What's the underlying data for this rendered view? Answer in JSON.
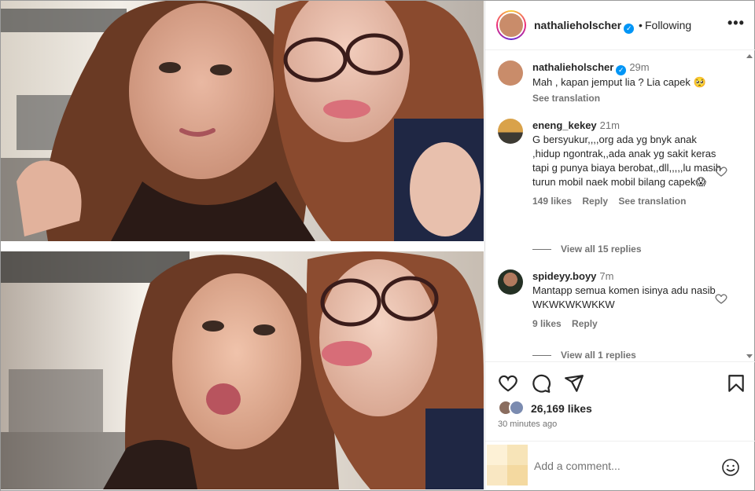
{
  "post": {
    "username": "nathalieholscher",
    "follow_status": "Following",
    "dot": "•",
    "more": "•••"
  },
  "caption": {
    "username": "nathalieholscher",
    "time": "29m",
    "text": "Mah , kapan jemput lia ? Lia capek 🥺",
    "see_translation": "See translation"
  },
  "comments": [
    {
      "username": "eneng_kekey",
      "time": "21m",
      "text": "G bersyukur,,,,org ada yg bnyk anak ,hidup ngontrak,,ada anak yg sakit keras tapi g punya biaya berobat,,dll,,,,,lu masih turun mobil naek mobil bilang capek😱",
      "likes": "149 likes",
      "reply": "Reply",
      "see_translation": "See translation",
      "view_replies": "View all 15 replies"
    },
    {
      "username": "spideyy.boyy",
      "time": "7m",
      "text": "Mantapp semua komen isinya adu nasib WKWKWKWKKW",
      "likes": "9 likes",
      "reply": "Reply",
      "view_replies": "View all 1 replies"
    }
  ],
  "engagement": {
    "likes": "26,169 likes",
    "time_ago": "30 minutes ago"
  },
  "composer": {
    "placeholder": "Add a comment..."
  },
  "icons": [
    "heart-icon",
    "comment-icon",
    "share-icon",
    "bookmark-icon",
    "emoji-icon",
    "verified-icon"
  ],
  "colors": {
    "verified": "#0095f6",
    "text": "#262626",
    "muted": "#737373",
    "border": "#dbdbdb"
  }
}
